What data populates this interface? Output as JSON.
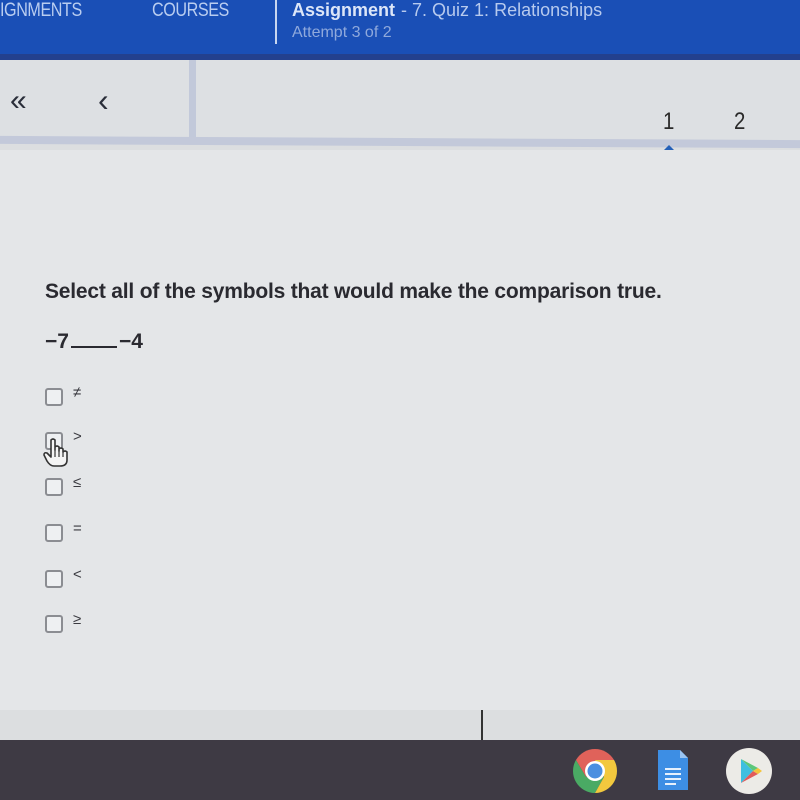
{
  "topbar": {
    "nav_assignments": "IGNMENTS",
    "nav_courses": "COURSES",
    "assignment_label": "Assignment",
    "assignment_title": "- 7. Quiz 1: Relationships",
    "attempt": "Attempt 3 of 2"
  },
  "navigation": {
    "first_icon": "«",
    "prev_icon": "‹",
    "pages": [
      "1",
      "2"
    ],
    "current_page": "1"
  },
  "question": {
    "prompt": "Select all of the symbols that would make the comparison true.",
    "left_value": "−7",
    "right_value": "−4",
    "options": [
      {
        "symbol": "≠",
        "checked": false
      },
      {
        "symbol": ">",
        "checked": false
      },
      {
        "symbol": "≤",
        "checked": false
      },
      {
        "symbol": "=",
        "checked": false
      },
      {
        "symbol": "<",
        "checked": false
      },
      {
        "symbol": "≥",
        "checked": false
      }
    ]
  },
  "shelf": {
    "apps": [
      "chrome-icon",
      "google-docs-icon",
      "play-store-icon"
    ]
  },
  "colors": {
    "topbar": "#1a4fb6",
    "accent": "#2460b8",
    "shelf": "#3e3a44"
  }
}
